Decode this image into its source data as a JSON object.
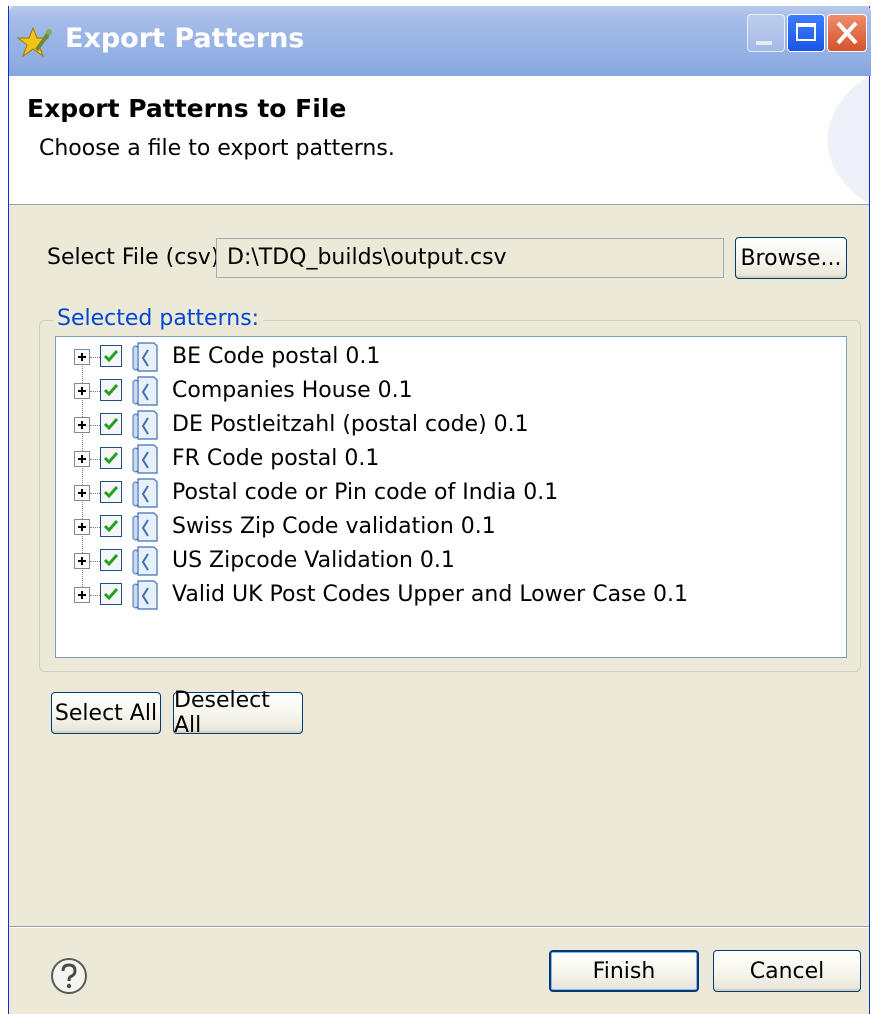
{
  "window": {
    "title": "Export Patterns",
    "controls": [
      "minimize",
      "maximize",
      "close"
    ],
    "title_icon": "wizard-star-icon"
  },
  "header": {
    "title": "Export Patterns to File",
    "description": "Choose a file to export patterns."
  },
  "file": {
    "label": "Select File (csv):",
    "value": "D:\\TDQ_builds\\output.csv",
    "browse_label": "Browse..."
  },
  "patterns": {
    "legend": "Selected patterns:",
    "items": [
      {
        "label": "BE Code postal 0.1",
        "checked": true
      },
      {
        "label": "Companies House 0.1",
        "checked": true
      },
      {
        "label": "DE Postleitzahl (postal code) 0.1",
        "checked": true
      },
      {
        "label": "FR Code postal 0.1",
        "checked": true
      },
      {
        "label": "Postal code or Pin code of India 0.1",
        "checked": true
      },
      {
        "label": "Swiss Zip Code validation 0.1",
        "checked": true
      },
      {
        "label": "US Zipcode Validation 0.1",
        "checked": true
      },
      {
        "label": "Valid UK Post Codes Upper and Lower Case 0.1",
        "checked": true
      }
    ]
  },
  "actions": {
    "select_all": "Select All",
    "deselect_all": "Deselect All",
    "finish": "Finish",
    "cancel": "Cancel",
    "help_icon": "help-icon"
  },
  "colors": {
    "titlebar": "#9ab4e6",
    "dialog_bg": "#ece9d8",
    "legend_text": "#0046d5",
    "check_green": "#21a121"
  }
}
